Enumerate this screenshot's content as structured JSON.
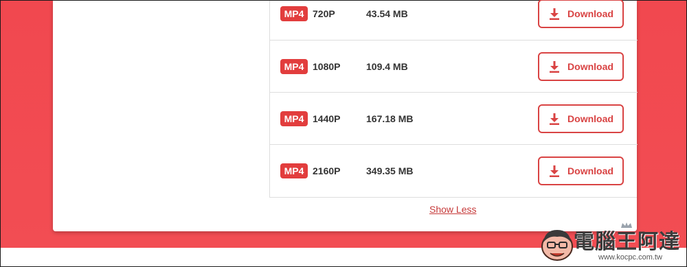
{
  "results": [
    {
      "format": "MP4",
      "quality": "720P",
      "size": "43.54 MB",
      "action": "Download"
    },
    {
      "format": "MP4",
      "quality": "1080P",
      "size": "109.4 MB",
      "action": "Download"
    },
    {
      "format": "MP4",
      "quality": "1440P",
      "size": "167.18 MB",
      "action": "Download"
    },
    {
      "format": "MP4",
      "quality": "2160P",
      "size": "349.35 MB",
      "action": "Download"
    }
  ],
  "show_less_label": "Show Less",
  "watermark": {
    "title": "電腦王阿達",
    "url": "www.kocpc.com.tw"
  },
  "icons": {
    "download": "download-icon"
  },
  "colors": {
    "accent": "#d94343",
    "badge": "#e23d3d",
    "background": "#f1484f"
  }
}
